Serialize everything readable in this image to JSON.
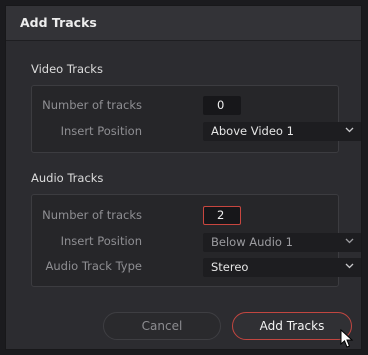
{
  "dialog": {
    "title": "Add Tracks"
  },
  "video": {
    "section_label": "Video Tracks",
    "num_label": "Number of tracks",
    "num_value": "0",
    "position_label": "Insert Position",
    "position_value": "Above Video 1"
  },
  "audio": {
    "section_label": "Audio Tracks",
    "num_label": "Number of tracks",
    "num_value": "2",
    "position_label": "Insert Position",
    "position_value": "Below Audio 1",
    "type_label": "Audio Track Type",
    "type_value": "Stereo"
  },
  "buttons": {
    "cancel": "Cancel",
    "add": "Add Tracks"
  },
  "icons": {
    "dropdown": "chevron-down-icon",
    "cursor": "mouse-pointer-icon"
  },
  "colors": {
    "accent": "#c8463f",
    "background": "#2c2c30"
  }
}
